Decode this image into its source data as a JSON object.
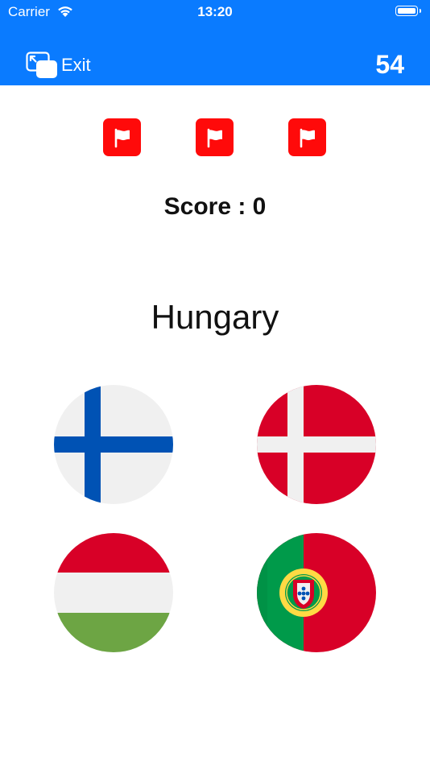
{
  "status_bar": {
    "carrier": "Carrier",
    "time": "13:20"
  },
  "header": {
    "exit_label": "Exit",
    "timer": "54"
  },
  "lives": {
    "count": 3,
    "icon": "flag-icon",
    "color": "#ff0a0a"
  },
  "game": {
    "score_text": "Score : 0",
    "question": "Hungary"
  },
  "options": [
    {
      "country": "Finland",
      "icon": "finland-flag"
    },
    {
      "country": "Denmark",
      "icon": "denmark-flag"
    },
    {
      "country": "Hungary",
      "icon": "hungary-flag"
    },
    {
      "country": "Portugal",
      "icon": "portugal-flag"
    }
  ],
  "colors": {
    "accent": "#0a7bff",
    "background": "#ffffff"
  }
}
